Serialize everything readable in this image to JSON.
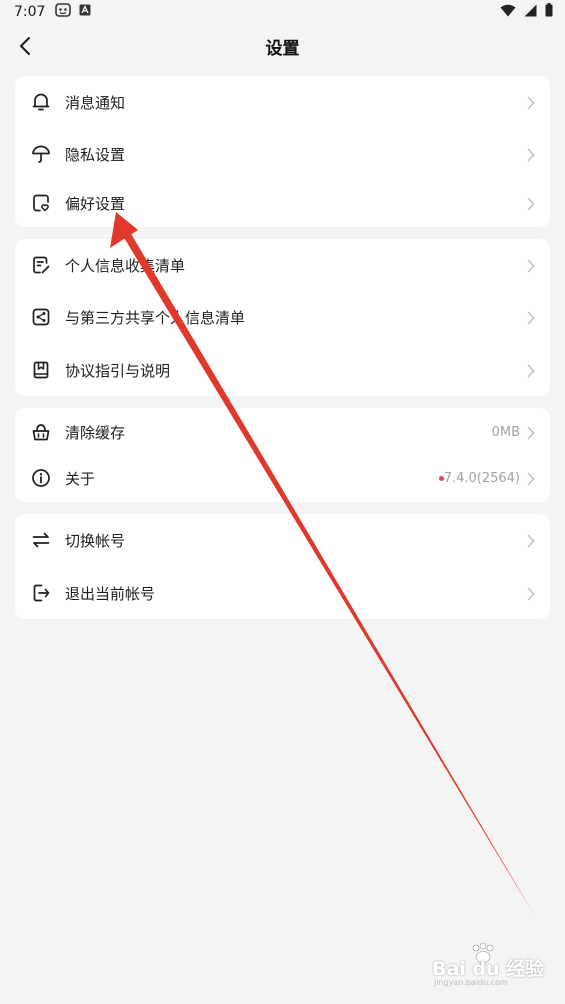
{
  "status_bar": {
    "time": "7:07"
  },
  "header": {
    "title": "设置"
  },
  "groups": [
    {
      "items": [
        {
          "label": "消息通知",
          "icon": "bell-icon"
        },
        {
          "label": "隐私设置",
          "icon": "umbrella-icon"
        },
        {
          "label": "偏好设置",
          "icon": "preference-heart-icon"
        }
      ]
    },
    {
      "items": [
        {
          "label": "个人信息收集清单",
          "icon": "document-edit-icon"
        },
        {
          "label": "与第三方共享个人信息清单",
          "icon": "share-icon"
        },
        {
          "label": "协议指引与说明",
          "icon": "book-icon"
        }
      ]
    },
    {
      "items": [
        {
          "label": "清除缓存",
          "icon": "basket-icon",
          "value": "0MB"
        },
        {
          "label": "关于",
          "icon": "info-icon",
          "value": "7.4.0(2564)",
          "badge_color": "#e8455f"
        }
      ]
    },
    {
      "items": [
        {
          "label": "切换帐号",
          "icon": "switch-arrows-icon"
        },
        {
          "label": "退出当前帐号",
          "icon": "logout-icon"
        }
      ]
    }
  ],
  "annotation": {
    "arrow_color": "#e0392b"
  },
  "watermark": {
    "text": "Bai du 经验",
    "subtext": "jingyan.baidu.com"
  }
}
